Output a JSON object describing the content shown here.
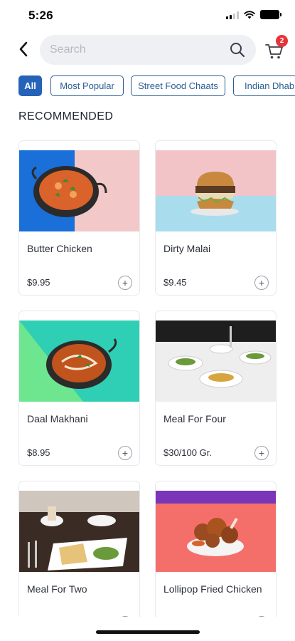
{
  "status_bar": {
    "time": "5:26"
  },
  "header": {
    "back_icon": "chevron-left-icon",
    "search": {
      "placeholder": "Search",
      "value": "",
      "icon": "search-icon"
    },
    "cart": {
      "icon": "cart-icon",
      "badge": "2"
    }
  },
  "filters": [
    {
      "label": "All",
      "active": true
    },
    {
      "label": "Most Popular",
      "active": false
    },
    {
      "label": "Street Food Chaats",
      "active": false
    },
    {
      "label": "Indian Dhab",
      "active": false
    }
  ],
  "section": {
    "title": "RECOMMENDED"
  },
  "items": [
    {
      "name": "Butter Chicken",
      "price": "$9.95"
    },
    {
      "name": "Dirty Malai",
      "price": "$9.45"
    },
    {
      "name": "Daal Makhani",
      "price": "$8.95"
    },
    {
      "name": "Meal For Four",
      "price": "$30/100 Gr."
    },
    {
      "name": "Meal For Two",
      "price": ""
    },
    {
      "name": "Lollipop Fried Chicken",
      "price": ""
    }
  ],
  "colors": {
    "accent": "#2563b8",
    "chip_border": "#2a5d95",
    "badge": "#e8333a",
    "search_bg": "#eef0f4"
  }
}
